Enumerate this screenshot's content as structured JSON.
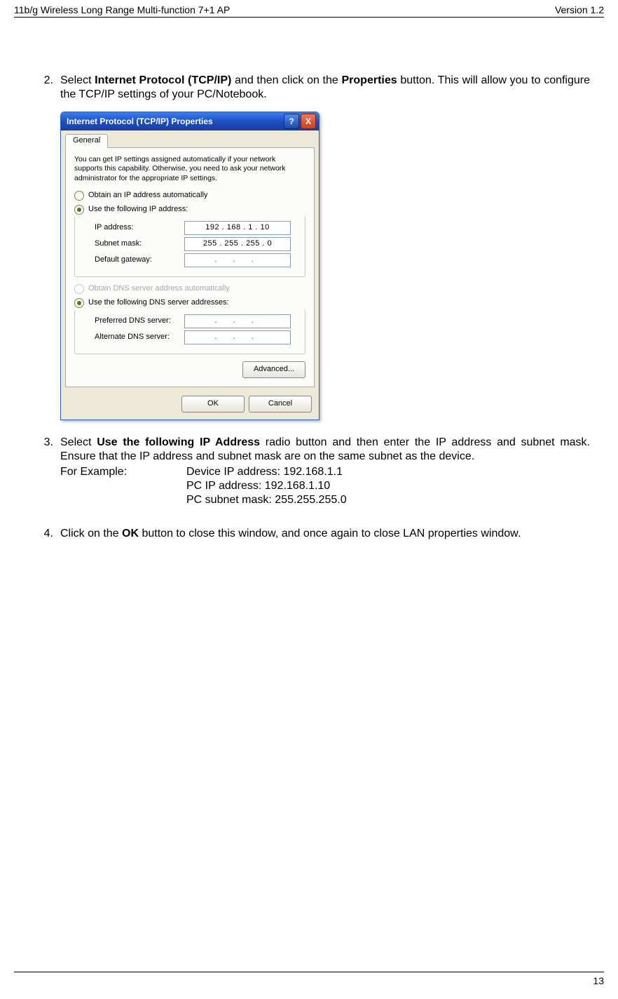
{
  "header": {
    "left": "11b/g Wireless Long Range Multi-function 7+1 AP",
    "right": "Version 1.2"
  },
  "step2": {
    "num": "2.",
    "pre": "Select ",
    "bold1": "Internet Protocol (TCP/IP)",
    "mid": " and then click on the ",
    "bold2": "Properties",
    "post": " button. This will allow you to configure the TCP/IP settings of your PC/Notebook."
  },
  "dialog": {
    "title": "Internet Protocol (TCP/IP) Properties",
    "help": "?",
    "close": "X",
    "tab": "General",
    "desc": "You can get IP settings assigned automatically if your network supports this capability. Otherwise, you need to ask your network administrator for the appropriate IP settings.",
    "radio_obtain_ip": "Obtain an IP address automatically",
    "radio_use_ip": "Use the following IP address:",
    "lbl_ip": "IP address:",
    "val_ip": "192 . 168 .   1   .  10",
    "lbl_mask": "Subnet mask:",
    "val_mask": "255 . 255 . 255 .   0",
    "lbl_gw": "Default gateway:",
    "val_gw": ".        .        .",
    "radio_obtain_dns": "Obtain DNS server address automatically",
    "radio_use_dns": "Use the following DNS server addresses:",
    "lbl_pref": "Preferred DNS server:",
    "val_pref": ".        .        .",
    "lbl_alt": "Alternate DNS server:",
    "val_alt": ".        .        .",
    "advanced": "Advanced...",
    "ok": "OK",
    "cancel": "Cancel"
  },
  "step3": {
    "num": "3.",
    "pre": "Select ",
    "bold": "Use the following IP Address",
    "post": " radio button and then enter the IP address and subnet mask. Ensure that the IP address and subnet mask are on the same subnet as the device.",
    "example_label": "For Example:",
    "line1": "Device IP address: 192.168.1.1",
    "line2": "PC IP address: 192.168.1.10",
    "line3": "PC subnet mask: 255.255.255.0"
  },
  "step4": {
    "num": "4.",
    "pre": "Click on the ",
    "bold": "OK",
    "post": " button to close this window, and once again to close LAN properties window."
  },
  "page_number": "13"
}
